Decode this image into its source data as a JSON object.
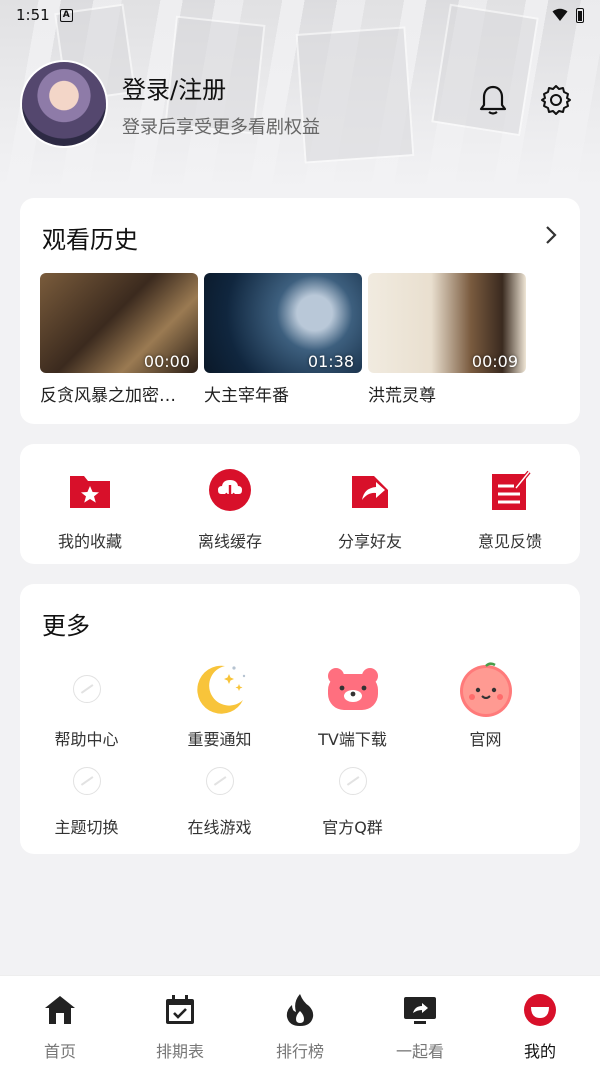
{
  "status_bar": {
    "time": "1:51",
    "notice_glyph": "A"
  },
  "profile": {
    "title": "登录/注册",
    "subtitle": "登录后享受更多看剧权益"
  },
  "history": {
    "title": "观看历史",
    "items": [
      {
        "title": "反贪风暴之加密…",
        "time": "00:00"
      },
      {
        "title": "大主宰年番",
        "time": "01:38"
      },
      {
        "title": "洪荒灵尊",
        "time": "00:09"
      }
    ]
  },
  "actions": [
    {
      "label": "我的收藏",
      "icon": "favorites-folder-icon"
    },
    {
      "label": "离线缓存",
      "icon": "cloud-download-icon"
    },
    {
      "label": "分享好友",
      "icon": "share-icon"
    },
    {
      "label": "意见反馈",
      "icon": "feedback-icon"
    }
  ],
  "more": {
    "title": "更多",
    "items": [
      {
        "label": "帮助中心",
        "icon": "placeholder-icon"
      },
      {
        "label": "重要通知",
        "icon": "moon-icon"
      },
      {
        "label": "TV端下载",
        "icon": "bear-icon"
      },
      {
        "label": "官网",
        "icon": "peach-icon"
      },
      {
        "label": "主题切换",
        "icon": "placeholder-icon"
      },
      {
        "label": "在线游戏",
        "icon": "placeholder-icon"
      },
      {
        "label": "官方Q群",
        "icon": "placeholder-icon"
      }
    ]
  },
  "tabs": [
    {
      "label": "首页",
      "icon": "home-icon",
      "active": false
    },
    {
      "label": "排期表",
      "icon": "calendar-icon",
      "active": false
    },
    {
      "label": "排行榜",
      "icon": "flame-icon",
      "active": false
    },
    {
      "label": "一起看",
      "icon": "screen-share-icon",
      "active": false
    },
    {
      "label": "我的",
      "icon": "profile-icon",
      "active": true
    }
  ],
  "colors": {
    "accent": "#d8102a",
    "text": "#222222",
    "muted": "#777777",
    "background": "#f2f2f4"
  }
}
